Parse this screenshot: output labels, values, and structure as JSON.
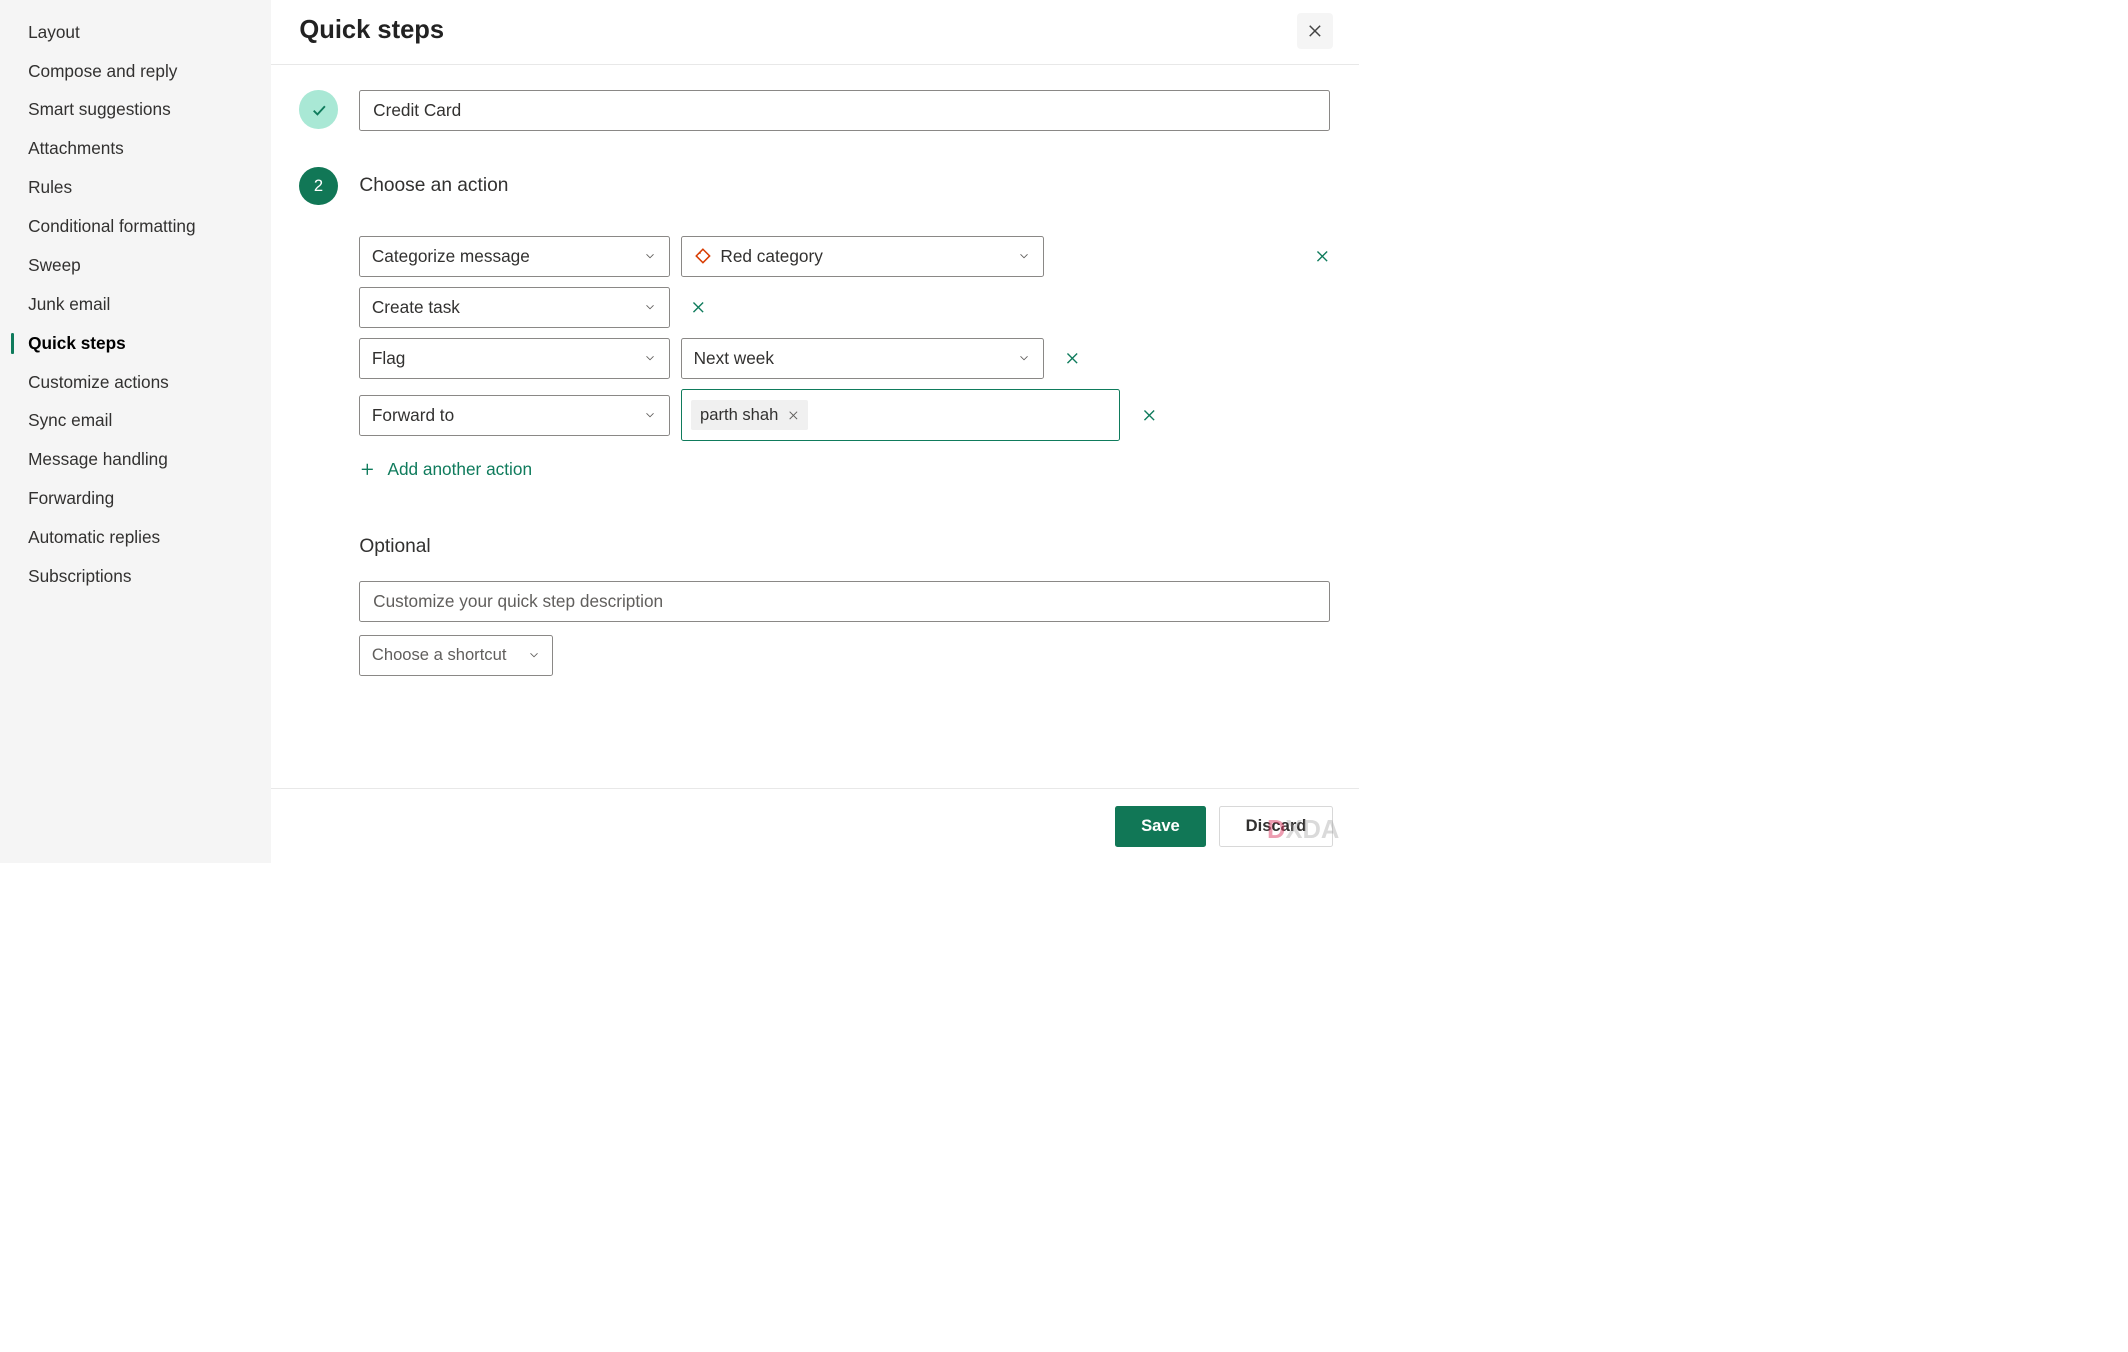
{
  "sidebar": {
    "items": [
      {
        "label": "Layout",
        "active": false
      },
      {
        "label": "Compose and reply",
        "active": false
      },
      {
        "label": "Smart suggestions",
        "active": false
      },
      {
        "label": "Attachments",
        "active": false
      },
      {
        "label": "Rules",
        "active": false
      },
      {
        "label": "Conditional formatting",
        "active": false
      },
      {
        "label": "Sweep",
        "active": false
      },
      {
        "label": "Junk email",
        "active": false
      },
      {
        "label": "Quick steps",
        "active": true
      },
      {
        "label": "Customize actions",
        "active": false
      },
      {
        "label": "Sync email",
        "active": false
      },
      {
        "label": "Message handling",
        "active": false
      },
      {
        "label": "Forwarding",
        "active": false
      },
      {
        "label": "Automatic replies",
        "active": false
      },
      {
        "label": "Subscriptions",
        "active": false
      }
    ]
  },
  "header": {
    "title": "Quick steps"
  },
  "step1": {
    "name_value": "Credit Card"
  },
  "step2": {
    "number": "2",
    "title": "Choose an action",
    "actions": [
      {
        "action": "Categorize message",
        "param": "Red category",
        "icon": "tag"
      },
      {
        "action": "Create task"
      },
      {
        "action": "Flag",
        "param": "Next week"
      },
      {
        "action": "Forward to",
        "recipient": "parth shah"
      }
    ],
    "add_action_label": "Add another action"
  },
  "optional": {
    "title": "Optional",
    "desc_placeholder": "Customize your quick step description",
    "shortcut_label": "Choose a shortcut"
  },
  "footer": {
    "save": "Save",
    "discard": "Discard"
  },
  "watermark": "DXDA"
}
